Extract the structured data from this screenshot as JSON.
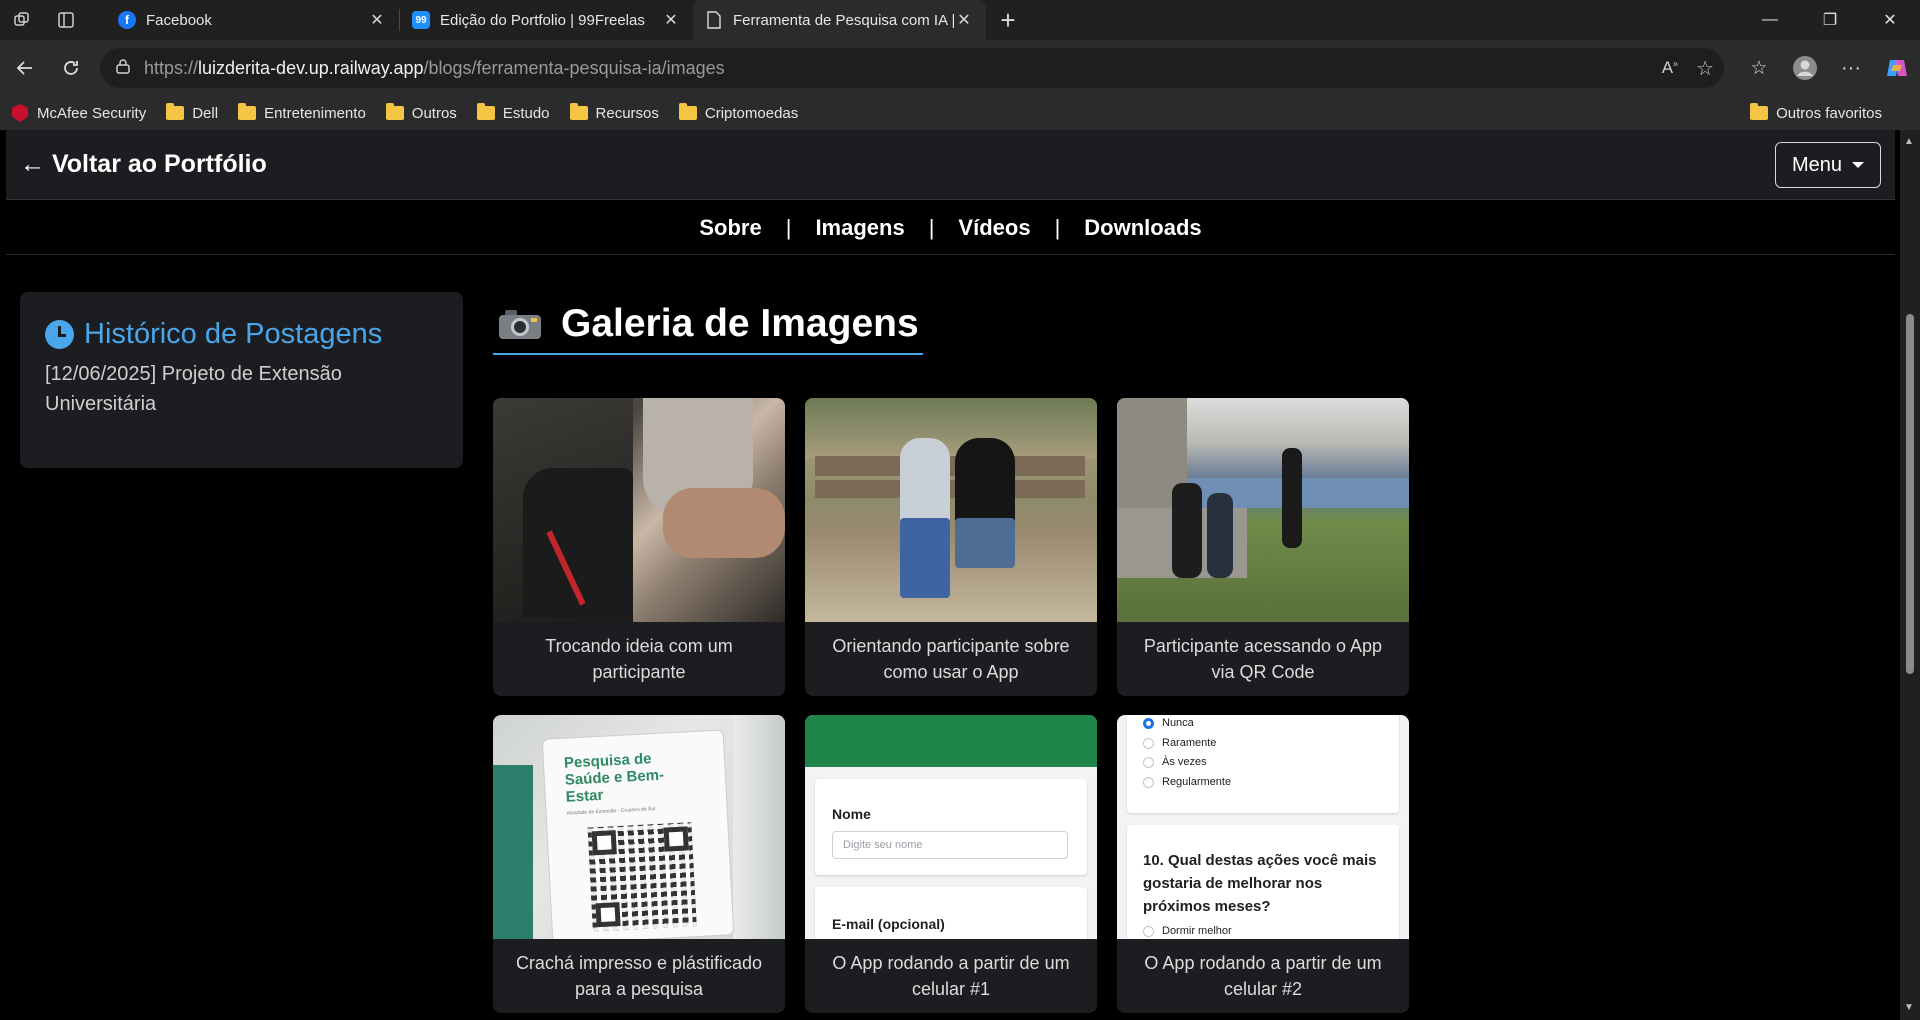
{
  "browser": {
    "tabs": [
      {
        "title": "Facebook",
        "favicon_color": "#1877f2",
        "favicon_glyph": "f"
      },
      {
        "title": "Edição do Portfolio | 99Freelas",
        "favicon_color": "#1e90ff",
        "favicon_glyph": "99"
      },
      {
        "title": "Ferramenta de Pesquisa com IA | L",
        "favicon_color": "#2b2b2b",
        "favicon_glyph": ""
      }
    ],
    "url_scheme": "https://",
    "url_host": "luizderita-dev.up.railway.app",
    "url_path": "/blogs/ferramenta-pesquisa-ia/images",
    "bookmarks": [
      "McAfee Security",
      "Dell",
      "Entretenimento",
      "Outros",
      "Estudo",
      "Recursos",
      "Criptomoedas"
    ],
    "other_bookmarks": "Outros favoritos"
  },
  "page": {
    "back_link": "← Voltar ao Portfólio",
    "menu_label": "Menu",
    "subnav": [
      "Sobre",
      "Imagens",
      "Vídeos",
      "Downloads"
    ],
    "sidebar": {
      "title": "Histórico de Postagens",
      "entry": "[12/06/2025] Projeto de Extensão Universitária"
    },
    "gallery_title": "Galeria de Imagens",
    "gallery": [
      {
        "caption": "Trocando ideia com um participante"
      },
      {
        "caption": "Orientando participante sobre como usar o App"
      },
      {
        "caption": "Participante acessando o App via QR Code"
      },
      {
        "caption": "Crachá impresso e plástificado para a pesquisa"
      },
      {
        "caption": "O App rodando a partir de um celular #1"
      },
      {
        "caption": "O App rodando a partir de um celular #2"
      }
    ],
    "badge_text": {
      "line1": "Pesquisa de",
      "line2": "Saúde e Bem-",
      "line3": "Estar",
      "small": "Atividade de Extensão - Cruzeiro do Sul"
    },
    "app1": {
      "name_label": "Nome",
      "name_placeholder": "Digite seu nome",
      "email_label": "E-mail (opcional)"
    },
    "app2": {
      "options": [
        "Nunca",
        "Raramente",
        "Às vezes",
        "Regularmente"
      ],
      "question": "10. Qual destas ações você mais gostaria de melhorar nos próximos meses?",
      "next_option": "Dormir melhor"
    }
  },
  "colors": {
    "accent": "#4aa6ea",
    "page_bg": "#000000",
    "card_bg": "#1c1d20",
    "app_green": "#1e8449"
  }
}
